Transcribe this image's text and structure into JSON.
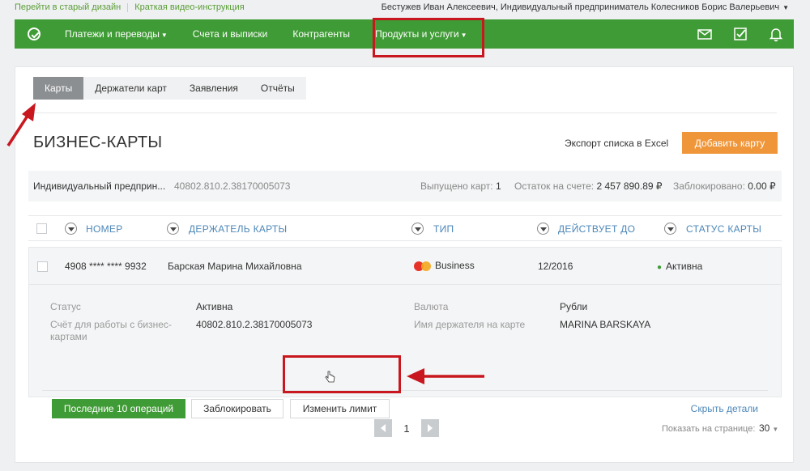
{
  "top_links": {
    "old_design": "Перейти в старый дизайн",
    "video": "Краткая видео-инструкция"
  },
  "user": {
    "name": "Бестужев Иван Алексеевич, Индивидуальный предприниматель Колесников Борис Валерьевич"
  },
  "nav": {
    "items": [
      {
        "label": "Платежи и переводы",
        "dropdown": true
      },
      {
        "label": "Счета и выписки",
        "dropdown": false
      },
      {
        "label": "Контрагенты",
        "dropdown": false
      },
      {
        "label": "Продукты и услуги",
        "dropdown": true
      }
    ],
    "icons": [
      "mail-icon",
      "checklist-icon",
      "bell-icon"
    ]
  },
  "tabs": [
    {
      "label": "Карты",
      "active": true
    },
    {
      "label": "Держатели карт",
      "active": false
    },
    {
      "label": "Заявления",
      "active": false
    },
    {
      "label": "Отчёты",
      "active": false
    }
  ],
  "page": {
    "title": "БИЗНЕС-КАРТЫ",
    "export_label": "Экспорт списка в Excel",
    "add_button": "Добавить карту"
  },
  "account": {
    "name": "Индивидуальный предприн...",
    "number": "40802.810.2.38170005073",
    "issued_label": "Выпущено карт:",
    "issued_value": "1",
    "balance_label": "Остаток на счете:",
    "balance_value": "2 457 890.89 ₽",
    "blocked_label": "Заблокировано:",
    "blocked_value": "0.00 ₽"
  },
  "table": {
    "columns": [
      "НОМЕР",
      "ДЕРЖАТЕЛЬ КАРТЫ",
      "ТИП",
      "ДЕЙСТВУЕТ ДО",
      "СТАТУС КАРТЫ"
    ],
    "rows": [
      {
        "number": "4908 **** **** 9932",
        "holder": "Барская Марина Михайловна",
        "type": "Business",
        "valid_until": "12/2016",
        "status": "Активна"
      }
    ]
  },
  "details": {
    "status_label": "Статус",
    "status_value": "Активна",
    "account_label": "Счёт для работы с бизнес-картами",
    "account_value": "40802.810.2.38170005073",
    "currency_label": "Валюта",
    "currency_value": "Рубли",
    "holder_name_label": "Имя держателя на карте",
    "holder_name_value": "MARINA BARSKAYA",
    "btn_last_ops": "Последние 10 операций",
    "btn_block": "Заблокировать",
    "btn_change_limit": "Изменить лимит",
    "hide_link": "Скрыть детали"
  },
  "pagination": {
    "current": "1",
    "per_page_label": "Показать на странице:",
    "per_page_value": "30"
  },
  "colors": {
    "brand_green": "#3f9b35",
    "accent_orange": "#f0963a",
    "annotation_red": "#c8171e",
    "link_blue": "#4c87b9"
  }
}
